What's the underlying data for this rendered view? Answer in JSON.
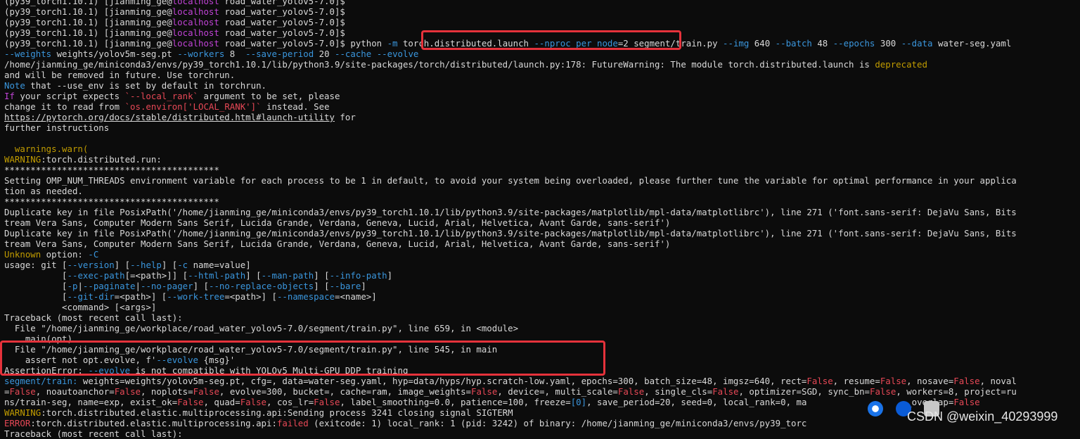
{
  "terminal": {
    "lines": [
      [
        [
          "(py39_torch1.10.1) [jianming_ge@",
          "w"
        ],
        [
          "localhost",
          "m"
        ],
        [
          " road_water_yolov5-7.0]$",
          "w"
        ]
      ],
      [
        [
          "(py39_torch1.10.1) [jianming_ge@",
          "w"
        ],
        [
          "localhost",
          "m"
        ],
        [
          " road_water_yolov5-7.0]$",
          "w"
        ]
      ],
      [
        [
          "(py39_torch1.10.1) [jianming_ge@",
          "w"
        ],
        [
          "localhost",
          "m"
        ],
        [
          " road_water_yolov5-7.0]$",
          "w"
        ]
      ],
      [
        [
          "(py39_torch1.10.1) [jianming_ge@",
          "w"
        ],
        [
          "localhost",
          "m"
        ],
        [
          " road_water_yolov5-7.0]$",
          "w"
        ]
      ],
      [
        [
          "(py39_torch1.10.1) [jianming_ge@",
          "w"
        ],
        [
          "localhost",
          "m"
        ],
        [
          " road_water_yolov5-7.0]$ python ",
          "w"
        ],
        [
          "-m",
          "b"
        ],
        [
          " torch.distributed.launch ",
          "w"
        ],
        [
          "--nproc_per_node",
          "b"
        ],
        [
          "=2 segment/train.py ",
          "w"
        ],
        [
          "--img",
          "b"
        ],
        [
          " 640 ",
          "w"
        ],
        [
          "--batch",
          "b"
        ],
        [
          " 48 ",
          "w"
        ],
        [
          "--epochs",
          "b"
        ],
        [
          " 300 ",
          "w"
        ],
        [
          "--data",
          "b"
        ],
        [
          " water-seg.yaml",
          "w"
        ]
      ],
      [
        [
          "--weights",
          "b"
        ],
        [
          " weights/yolov5m-seg.pt ",
          "w"
        ],
        [
          "--workers",
          "b"
        ],
        [
          " 8  ",
          "w"
        ],
        [
          "--save-period",
          "b"
        ],
        [
          " 20 ",
          "w"
        ],
        [
          "--cache",
          "b"
        ],
        [
          " ",
          "w"
        ],
        [
          "--evolve",
          "b"
        ]
      ],
      [
        [
          "/home/jianming_ge/miniconda3/envs/py39_torch1.10.1/lib/python3.9/site-packages/torch/distributed/launch.py:178: FutureWarning: The module torch.distributed.launch is ",
          "w"
        ],
        [
          "deprecated",
          "y"
        ]
      ],
      [
        [
          "and will be removed in future. Use torchrun.",
          "w"
        ]
      ],
      [
        [
          "Note",
          "b"
        ],
        [
          " that --use_env is set by default in torchrun.",
          "w"
        ]
      ],
      [
        [
          "If",
          "m"
        ],
        [
          " your script expects ",
          "w"
        ],
        [
          "`--local_rank`",
          "r"
        ],
        [
          " argument to be set, please",
          "w"
        ]
      ],
      [
        [
          "change it to read from ",
          "w"
        ],
        [
          "`os.environ['LOCAL_RANK']`",
          "r"
        ],
        [
          " instead. See",
          "w"
        ]
      ],
      [
        [
          "https://pytorch.org/docs/stable/distributed.html#launch-utility",
          "u"
        ],
        [
          " for",
          "w"
        ]
      ],
      [
        [
          "further instructions",
          "w"
        ]
      ],
      [
        [
          "",
          "w"
        ]
      ],
      [
        [
          "  warnings.warn(",
          "y"
        ]
      ],
      [
        [
          "WARNING",
          "y"
        ],
        [
          ":torch.distributed.run:",
          "w"
        ]
      ],
      [
        [
          "*****************************************",
          "w"
        ]
      ],
      [
        [
          "Setting OMP_NUM_THREADS environment variable for each process to be 1 in default, to avoid your system being overloaded, please further tune the variable for optimal performance in your applica",
          "w"
        ]
      ],
      [
        [
          "tion as needed.",
          "w"
        ]
      ],
      [
        [
          "*****************************************",
          "w"
        ]
      ],
      [
        [
          "Duplicate key in file PosixPath('/home/jianming_ge/miniconda3/envs/py39_torch1.10.1/lib/python3.9/site-packages/matplotlib/mpl-data/matplotlibrc'), line 271 ('font.sans-serif: DejaVu Sans, Bits",
          "w"
        ]
      ],
      [
        [
          "tream Vera Sans, Computer Modern Sans Serif, Lucida Grande, Verdana, Geneva, Lucid, Arial, Helvetica, Avant Garde, sans-serif')",
          "w"
        ]
      ],
      [
        [
          "Duplicate key in file PosixPath('/home/jianming_ge/miniconda3/envs/py39_torch1.10.1/lib/python3.9/site-packages/matplotlib/mpl-data/matplotlibrc'), line 271 ('font.sans-serif: DejaVu Sans, Bits",
          "w"
        ]
      ],
      [
        [
          "tream Vera Sans, Computer Modern Sans Serif, Lucida Grande, Verdana, Geneva, Lucid, Arial, Helvetica, Avant Garde, sans-serif')",
          "w"
        ]
      ],
      [
        [
          "Unknown",
          "y"
        ],
        [
          " option: ",
          "w"
        ],
        [
          "-C",
          "b"
        ]
      ],
      [
        [
          "usage: git [",
          "w"
        ],
        [
          "--version",
          "b"
        ],
        [
          "] [",
          "w"
        ],
        [
          "--help",
          "b"
        ],
        [
          "] [",
          "w"
        ],
        [
          "-c",
          "b"
        ],
        [
          " name=value]",
          "w"
        ]
      ],
      [
        [
          "           [",
          "w"
        ],
        [
          "--exec-path",
          "b"
        ],
        [
          "[=<path>]] [",
          "w"
        ],
        [
          "--html-path",
          "b"
        ],
        [
          "] [",
          "w"
        ],
        [
          "--man-path",
          "b"
        ],
        [
          "] [",
          "w"
        ],
        [
          "--info-path",
          "b"
        ],
        [
          "]",
          "w"
        ]
      ],
      [
        [
          "           [",
          "w"
        ],
        [
          "-p",
          "b"
        ],
        [
          "|",
          "w"
        ],
        [
          "--paginate",
          "b"
        ],
        [
          "|",
          "w"
        ],
        [
          "--no-pager",
          "b"
        ],
        [
          "] [",
          "w"
        ],
        [
          "--no-replace-objects",
          "b"
        ],
        [
          "] [",
          "w"
        ],
        [
          "--bare",
          "b"
        ],
        [
          "]",
          "w"
        ]
      ],
      [
        [
          "           [",
          "w"
        ],
        [
          "--git-dir",
          "b"
        ],
        [
          "=<path>] [",
          "w"
        ],
        [
          "--work-tree",
          "b"
        ],
        [
          "=<path>] [",
          "w"
        ],
        [
          "--namespace",
          "b"
        ],
        [
          "=<name>]",
          "w"
        ]
      ],
      [
        [
          "           <command> [<args>]",
          "w"
        ]
      ],
      [
        [
          "Traceback (most recent call last):",
          "w"
        ]
      ],
      [
        [
          "  File \"/home/jianming_ge/workplace/road_water_yolov5-7.0/segment/train.py\", line 659, in <module>",
          "w"
        ]
      ],
      [
        [
          "    main(opt)",
          "w"
        ]
      ],
      [
        [
          "  File \"/home/jianming_ge/workplace/road_water_yolov5-7.0/segment/train.py\", line 545, in main",
          "w"
        ]
      ],
      [
        [
          "    assert not opt.evolve, f'",
          "w"
        ],
        [
          "--evolve",
          "b"
        ],
        [
          " {msg}'",
          "w"
        ]
      ],
      [
        [
          "AssertionError: ",
          "w"
        ],
        [
          "--evolve",
          "b"
        ],
        [
          " is not compatible with YOLOv5 Multi-GPU DDP training",
          "w"
        ]
      ],
      [
        [
          "segment/train: ",
          "b"
        ],
        [
          "weights=weights/yolov5m-seg.pt, cfg=, data=water-seg.yaml, hyp=data/hyps/hyp.scratch-low.yaml, epochs=300, batch_size=48, imgsz=640, rect=",
          "w"
        ],
        [
          "False",
          "r"
        ],
        [
          ", resume=",
          "w"
        ],
        [
          "False",
          "r"
        ],
        [
          ", nosave=",
          "w"
        ],
        [
          "False",
          "r"
        ],
        [
          ", noval",
          "w"
        ]
      ],
      [
        [
          "=",
          "w"
        ],
        [
          "False",
          "r"
        ],
        [
          ", noautoanchor=",
          "w"
        ],
        [
          "False",
          "r"
        ],
        [
          ", noplots=",
          "w"
        ],
        [
          "False",
          "r"
        ],
        [
          ", evolve=300, bucket=, cache=ram, image_weights=",
          "w"
        ],
        [
          "False",
          "r"
        ],
        [
          ", device=, multi_scale=",
          "w"
        ],
        [
          "False",
          "r"
        ],
        [
          ", single_cls=",
          "w"
        ],
        [
          "False",
          "r"
        ],
        [
          ", optimizer=SGD, sync_bn=",
          "w"
        ],
        [
          "False",
          "r"
        ],
        [
          ", workers=8, project=ru",
          "w"
        ]
      ],
      [
        [
          "ns/train-seg, name=exp, exist_ok=",
          "w"
        ],
        [
          "False",
          "r"
        ],
        [
          ", quad=",
          "w"
        ],
        [
          "False",
          "r"
        ],
        [
          ", cos_lr=",
          "w"
        ],
        [
          "False",
          "r"
        ],
        [
          ", label_smoothing=0.0, patience=100, freeze=",
          "w"
        ],
        [
          "[0]",
          "b"
        ],
        [
          ", save_period=20, seed=0, local_rank=0, ma",
          "w"
        ],
        [
          "                   ",
          "w"
        ],
        [
          "_overlap=",
          "w"
        ],
        [
          "False",
          "r"
        ]
      ],
      [
        [
          "WARNING",
          "y"
        ],
        [
          ":torch.distributed.elastic.multiprocessing.api:Sending process 3241 closing signal SIGTERM",
          "w"
        ]
      ],
      [
        [
          "ERROR",
          "r"
        ],
        [
          ":torch.distributed.elastic.multiprocessing.api:",
          "w"
        ],
        [
          "failed",
          "r"
        ],
        [
          " (exitcode: 1) local_rank: 1 (pid: 3242) of binary: /home/jianming_ge/miniconda3/envs/py39_torc",
          "w"
        ]
      ],
      [
        [
          "Traceback (most recent call last):",
          "w"
        ]
      ]
    ]
  },
  "watermark": "CSDN @weixin_40293999"
}
